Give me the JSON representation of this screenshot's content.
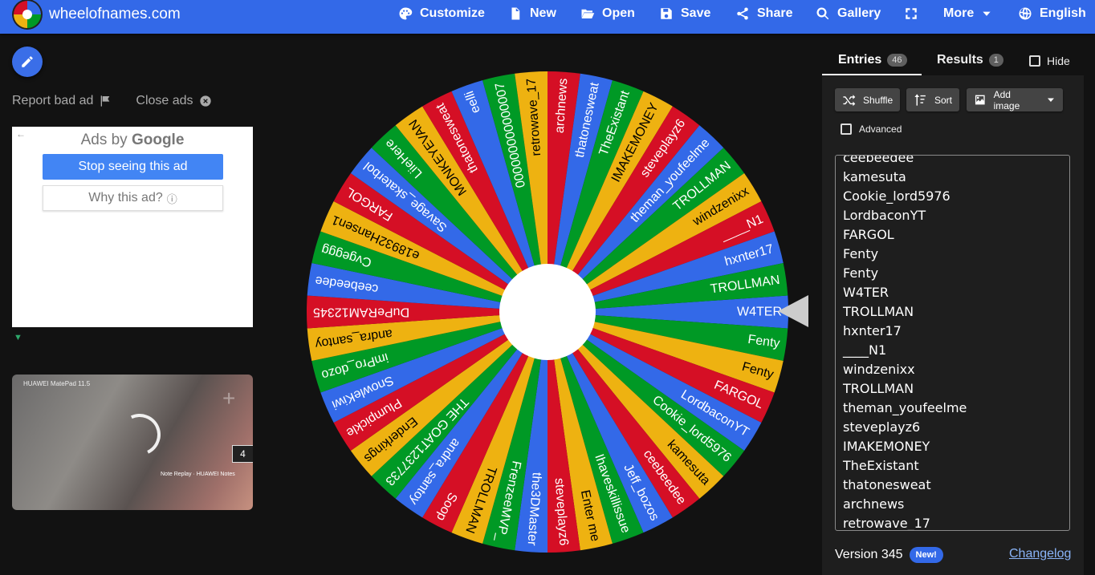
{
  "header": {
    "site_name": "wheelofnames.com",
    "nav": [
      {
        "label": "Customize",
        "icon": "palette-icon"
      },
      {
        "label": "New",
        "icon": "file-icon"
      },
      {
        "label": "Open",
        "icon": "folder-open-icon"
      },
      {
        "label": "Save",
        "icon": "floppy-disk-icon"
      },
      {
        "label": "Share",
        "icon": "share-icon"
      },
      {
        "label": "Gallery",
        "icon": "search-icon"
      },
      {
        "label": "",
        "icon": "fullscreen-icon"
      },
      {
        "label": "More",
        "icon": "caret-down-icon"
      },
      {
        "label": "English",
        "icon": "globe-icon"
      }
    ]
  },
  "ads": {
    "report_label": "Report bad ad",
    "close_label": "Close ads",
    "ads_by_prefix": "Ads by",
    "ads_by_brand": "Google",
    "stop_label": "Stop seeing this ad",
    "why_label": "Why this ad?",
    "video_brand": "HUAWEI MatePad 11.5",
    "video_count": "4",
    "video_caption": "Note Replay · HUAWEI Notes"
  },
  "wheel": {
    "colors": [
      "#3369e8",
      "#009925",
      "#eeb211",
      "#d50f25"
    ],
    "pointer_color": "#cccccc",
    "segments": [
      "W4TER",
      "Fenty",
      "Fenty",
      "FARGOL",
      "LordbaconYT",
      "Cookie_lord5976",
      "kamesuta",
      "ceebeedee",
      "Jeff_bozos",
      "Ihaveskillissue",
      "Enter me",
      "steveplayz6",
      "the3DMaster",
      "FrenzeeMVP_",
      "TROLLMAN",
      "Soop",
      "andra_santoy",
      "THE GOAT1237733",
      "Enderkings",
      "Plumpickle",
      "SnowleKiwi",
      "imPro_dozo",
      "andra_santoy",
      "DuPeRAM12345",
      "ceebeedee",
      "Cvgeggg",
      "e18932Hansen1",
      "FARGOL",
      "Savage_skaterbol",
      "LiieHere",
      "MONKEYEVAN",
      "thatonesweat",
      "eelli",
      "000000000000007",
      "retrowave_17",
      "archnews",
      "thatonesweat",
      "TheExistant",
      "IMAKEMONEY",
      "steveplayz6",
      "theman_youfeelme",
      "TROLLMAN",
      "windzenixx",
      "____N1",
      "hxnter17",
      "TROLLMAN"
    ]
  },
  "panel": {
    "tabs": [
      {
        "label": "Entries",
        "count": "46"
      },
      {
        "label": "Results",
        "count": "1"
      }
    ],
    "hide_label": "Hide",
    "buttons": [
      {
        "label": "Shuffle",
        "icon": "shuffle-icon"
      },
      {
        "label": "Sort",
        "icon": "sort-icon"
      },
      {
        "label": "Add image",
        "icon": "image-icon"
      }
    ],
    "advanced_label": "Advanced",
    "entries_visible": [
      "ceebeedee",
      "kamesuta",
      "Cookie_lord5976",
      "LordbaconYT",
      "FARGOL",
      "Fenty",
      "Fenty",
      "W4TER",
      "TROLLMAN",
      "hxnter17",
      "____N1",
      "windzenixx",
      "TROLLMAN",
      "theman_youfeelme",
      "steveplayz6",
      "IMAKEMONEY",
      "TheExistant",
      "thatonesweat",
      "archnews",
      "retrowave_17"
    ],
    "version_label": "Version 345",
    "new_badge": "New!",
    "changelog_label": "Changelog"
  }
}
